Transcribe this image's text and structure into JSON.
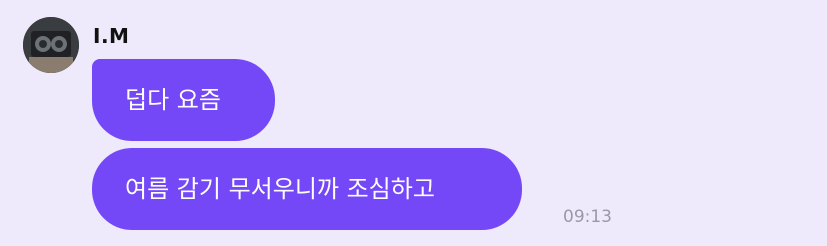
{
  "chat": {
    "sender": {
      "name": "I.M",
      "avatar": "profile-photo"
    },
    "messages": [
      {
        "text": "덥다 요즘"
      },
      {
        "text": "여름 감기 무서우니까 조심하고"
      }
    ],
    "timestamp": "09:13",
    "colors": {
      "background": "#eeeafc",
      "bubble": "#7448f7",
      "bubble_text": "#ffffff",
      "timestamp": "#9a98a8"
    }
  }
}
